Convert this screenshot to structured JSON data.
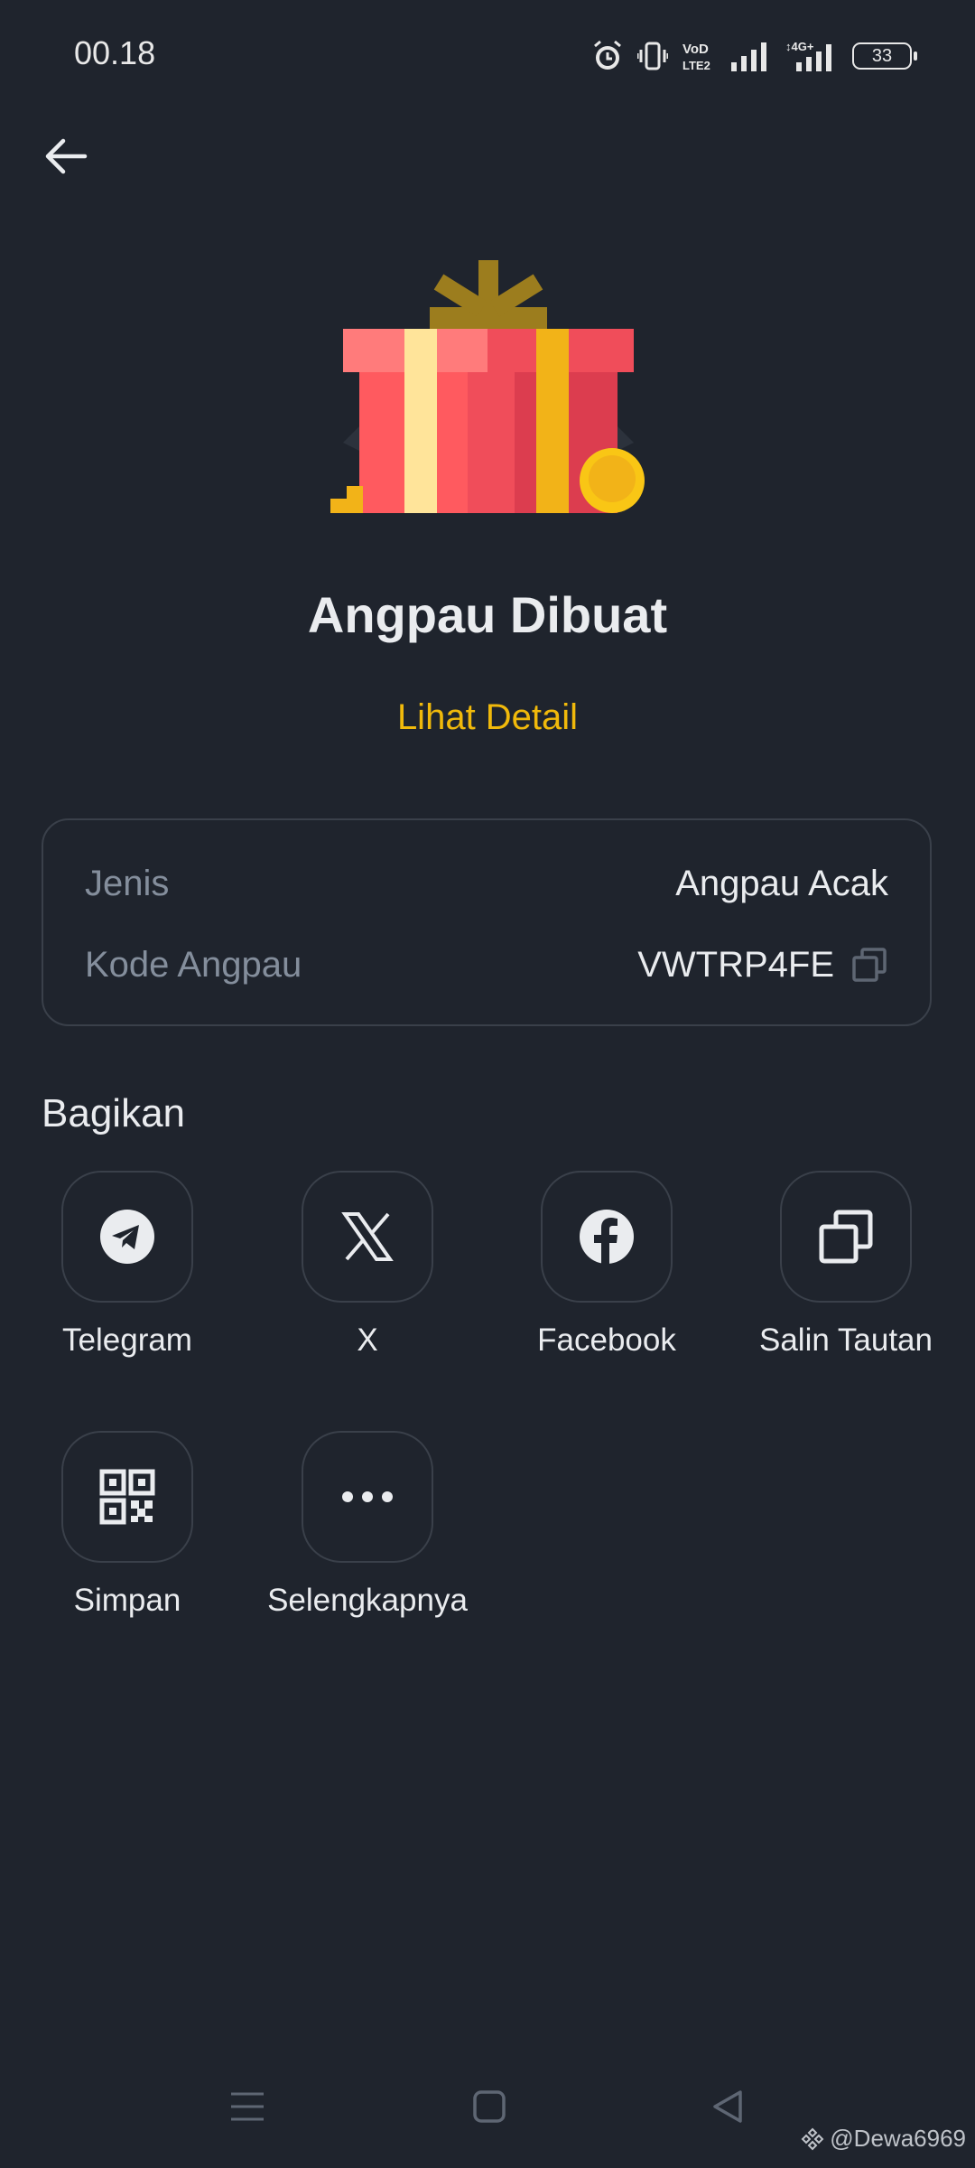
{
  "status_bar": {
    "time": "00.18",
    "battery": "33",
    "icons": [
      "alarm-icon",
      "vibrate-icon",
      "volte-icon",
      "signal-icon",
      "4g-signal-icon",
      "battery-icon"
    ]
  },
  "header": {
    "back_icon": "back-arrow-icon"
  },
  "hero": {
    "title": "Angpau Dibuat",
    "detail_link": "Lihat Detail"
  },
  "info": {
    "type_label": "Jenis",
    "type_value": "Angpau Acak",
    "code_label": "Kode Angpau",
    "code_value": "VWTRP4FE"
  },
  "share": {
    "heading": "Bagikan",
    "items": [
      {
        "label": "Telegram",
        "icon": "telegram-icon"
      },
      {
        "label": "X",
        "icon": "x-icon"
      },
      {
        "label": "Facebook",
        "icon": "facebook-icon"
      },
      {
        "label": "Salin Tautan",
        "icon": "copy-link-icon"
      },
      {
        "label": "Simpan",
        "icon": "qr-code-icon"
      },
      {
        "label": "Selengkapnya",
        "icon": "more-icon"
      }
    ]
  },
  "watermark": "@Dewa6969",
  "colors": {
    "background": "#1f242d",
    "accent": "#f0b90b",
    "text": "#eaecef",
    "muted": "#848e9c"
  }
}
